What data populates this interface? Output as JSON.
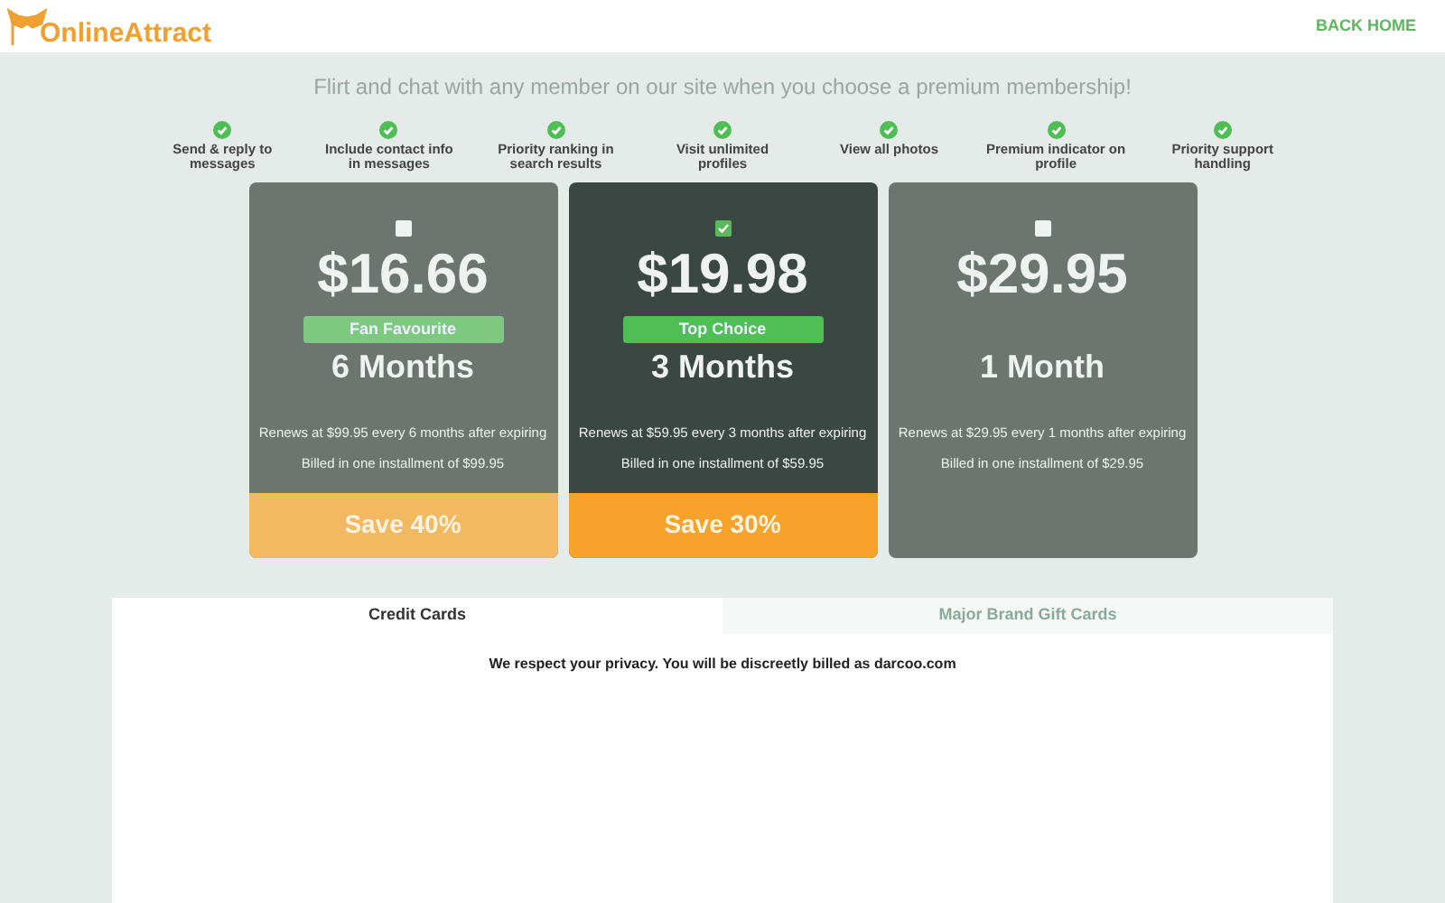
{
  "header": {
    "logo": "OnlineAttract",
    "back_link": "BACK HOME"
  },
  "headline": "Flirt and chat with any member on our site when you choose a premium membership!",
  "features": [
    "Send & reply to messages",
    "Include contact info in messages",
    "Priority ranking in search results",
    "Visit unlimited profiles",
    "View all photos",
    "Premium indicator on profile",
    "Priority support handling"
  ],
  "plans": [
    {
      "price": "$16.66",
      "badge": "Fan Favourite",
      "duration": "6 Months",
      "renews": "Renews at $99.95 every 6 months after expiring",
      "billed": "Billed in one installment of $99.95",
      "save": "Save 40%",
      "selected": false
    },
    {
      "price": "$19.98",
      "badge": "Top Choice",
      "duration": "3 Months",
      "renews": "Renews at $59.95 every 3 months after expiring",
      "billed": "Billed in one installment of $59.95",
      "save": "Save 30%",
      "selected": true
    },
    {
      "price": "$29.95",
      "duration": "1 Month",
      "renews": "Renews at $29.95 every 1 months after expiring",
      "billed": "Billed in one installment of $29.95",
      "selected": false
    }
  ],
  "payment_tabs": [
    {
      "label": "Credit Cards",
      "selected": true
    },
    {
      "label": "Major Brand Gift Cards",
      "selected": false
    }
  ],
  "privacy_note": "We respect your privacy. You will be discreetly billed as darcoo.com"
}
